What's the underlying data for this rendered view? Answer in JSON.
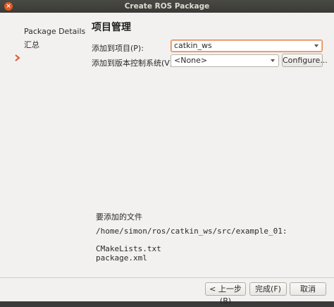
{
  "window": {
    "title": "Create ROS Package",
    "close_glyph": "×"
  },
  "sidebar": {
    "items": [
      {
        "label": "Package Details"
      },
      {
        "label": "汇总",
        "current": true
      }
    ]
  },
  "page": {
    "title": "项目管理",
    "project_label": "添加到项目(P):",
    "project_value": "catkin_ws",
    "vcs_label": "添加到版本控制系统(V):",
    "vcs_value": "<None>",
    "configure_label": "Configure..."
  },
  "files": {
    "title": "要添加的文件",
    "path": "/home/simon/ros/catkin_ws/src/example_01:",
    "list": [
      "CMakeLists.txt",
      "package.xml"
    ]
  },
  "footer": {
    "back_label": "< 上一步(B)",
    "finish_label": "完成(F)",
    "cancel_label": "取消"
  },
  "colors": {
    "focus_accent": "#e4854a",
    "current_step_arrow": "#d9572b"
  }
}
